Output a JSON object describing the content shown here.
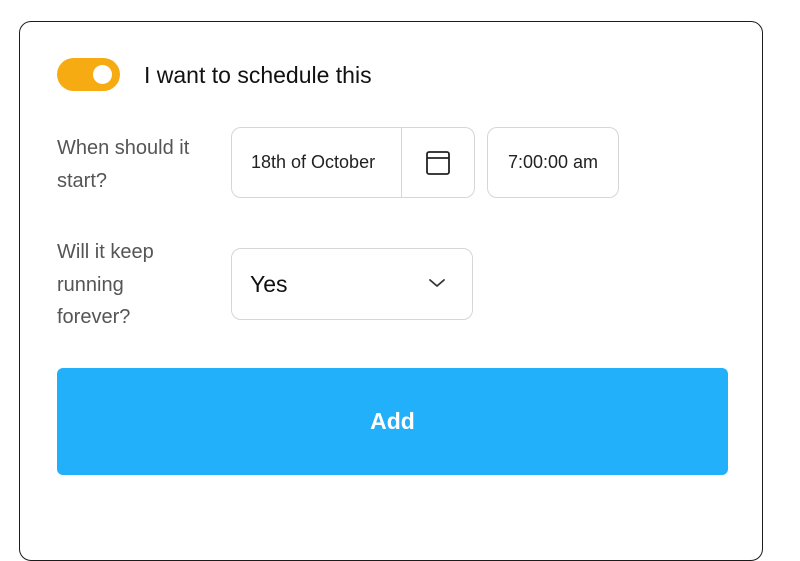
{
  "schedule_toggle": {
    "label": "I want to schedule this",
    "on": true,
    "color": "#f7ab12"
  },
  "start": {
    "label": "When should it start?",
    "date_value": "18th of October",
    "calendar_icon": "calendar-icon",
    "time_value": "7:00:00 am"
  },
  "forever": {
    "label": "Will it keep running forever?",
    "selected": "Yes",
    "chevron_icon": "chevron-down-icon"
  },
  "add_button": {
    "label": "Add",
    "color": "#22b0fb"
  }
}
